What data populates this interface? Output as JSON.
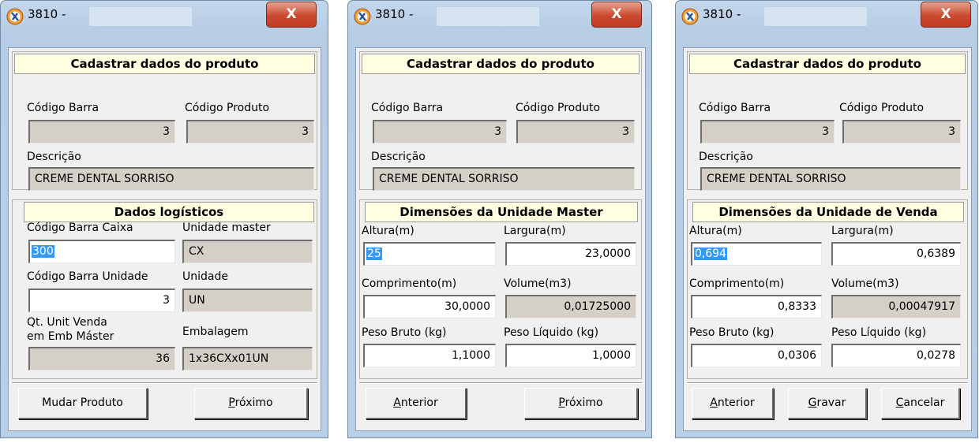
{
  "colors": {
    "titlebar": "#b9cfe6",
    "close": "#cb4a2f",
    "panel_header": "#ffffe1",
    "readonly_field": "#d4d0c8",
    "selection": "#3399ff"
  },
  "windows": [
    {
      "title": "3810 -",
      "close_glyph": "X",
      "header": "Cadastrar dados do produto",
      "codigo_barra_label": "Código Barra",
      "codigo_barra_value": "3",
      "codigo_produto_label": "Código Produto",
      "codigo_produto_value": "3",
      "descricao_label": "Descrição",
      "descricao_value": "CREME DENTAL SORRISO",
      "section_title": "Dados logísticos",
      "cb_caixa_label": "Código Barra Caixa",
      "cb_caixa_value": "300",
      "unidade_master_label": "Unidade master",
      "unidade_master_value": "CX",
      "cb_unidade_label": "Código Barra Unidade",
      "cb_unidade_value": "3",
      "unidade_label": "Unidade",
      "unidade_value": "UN",
      "qt_unit_label_1": "Qt. Unit Venda",
      "qt_unit_label_2": "em Emb Máster",
      "qt_unit_value": "36",
      "embalagem_label": "Embalagem",
      "embalagem_value": "1x36CXx01UN",
      "btn_mudar": "Mudar Produto",
      "btn_proximo_u": "P",
      "btn_proximo_rest": "róximo"
    },
    {
      "title": "3810 -",
      "close_glyph": "X",
      "header": "Cadastrar dados do produto",
      "codigo_barra_label": "Código Barra",
      "codigo_barra_value": "3",
      "codigo_produto_label": "Código Produto",
      "codigo_produto_value": "3",
      "descricao_label": "Descrição",
      "descricao_value": "CREME DENTAL SORRISO",
      "section_title": "Dimensões da Unidade Master",
      "altura_label": "Altura(m)",
      "altura_value": "25",
      "largura_label": "Largura(m)",
      "largura_value": "23,0000",
      "comprimento_label": "Comprimento(m)",
      "comprimento_value": "30,0000",
      "volume_label": "Volume(m3)",
      "volume_value": "0,01725000",
      "peso_bruto_label": "Peso Bruto (kg)",
      "peso_bruto_value": "1,1000",
      "peso_liquido_label": "Peso Líquido (kg)",
      "peso_liquido_value": "1,0000",
      "btn_anterior_u": "A",
      "btn_anterior_rest": "nterior",
      "btn_proximo_u": "P",
      "btn_proximo_rest": "róximo"
    },
    {
      "title": "3810 -",
      "close_glyph": "X",
      "header": "Cadastrar dados do produto",
      "codigo_barra_label": "Código Barra",
      "codigo_barra_value": "3",
      "codigo_produto_label": "Código Produto",
      "codigo_produto_value": "3",
      "descricao_label": "Descrição",
      "descricao_value": "CREME DENTAL SORRISO",
      "section_title": "Dimensões da Unidade de Venda",
      "altura_label": "Altura(m)",
      "altura_value": "0,694",
      "largura_label": "Largura(m)",
      "largura_value": "0,6389",
      "comprimento_label": "Comprimento(m)",
      "comprimento_value": "0,8333",
      "volume_label": "Volume(m3)",
      "volume_value": "0,00047917",
      "peso_bruto_label": "Peso Bruto (kg)",
      "peso_bruto_value": "0,0306",
      "peso_liquido_label": "Peso Líquido (kg)",
      "peso_liquido_value": "0,0278",
      "btn_anterior_u": "A",
      "btn_anterior_rest": "nterior",
      "btn_gravar_u": "G",
      "btn_gravar_rest": "ravar",
      "btn_cancelar_u": "C",
      "btn_cancelar_rest": "ancelar"
    }
  ]
}
